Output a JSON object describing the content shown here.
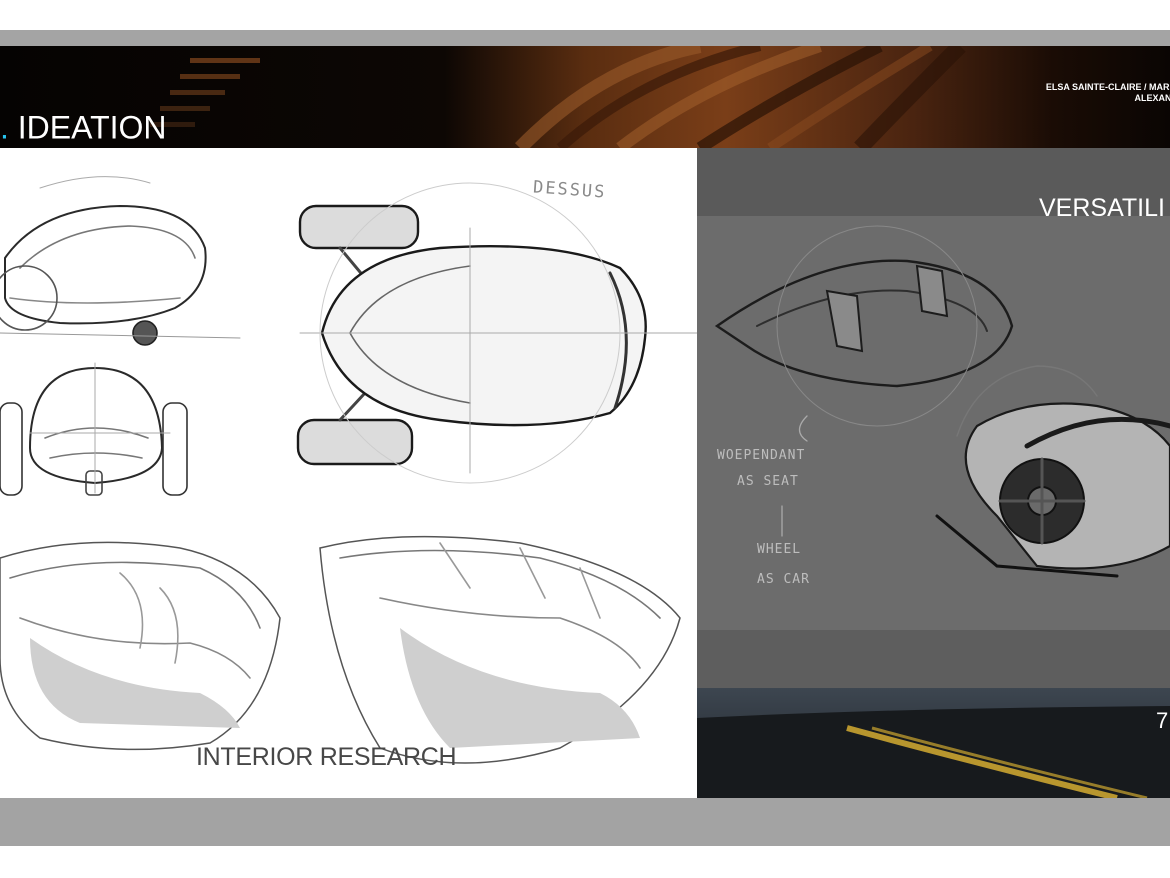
{
  "header": {
    "title_accent": ".",
    "title": " IDEATION",
    "credits_line1": "ELSA SAINTE-CLAIRE / MARIE",
    "credits_line2": "ALEXAND"
  },
  "left_panel": {
    "top_view_label": "DESSUS",
    "caption": "INTERIOR RESEARCH"
  },
  "right_panel": {
    "title": "VERSATILI",
    "handwriting": [
      "WOEPENDANT",
      "AS SEAT",
      "WHEEL",
      "AS CAR"
    ],
    "page_number": "7"
  },
  "colors": {
    "accent": "#27c4f0",
    "header_bg": "#0a0604",
    "right_panel_bg": "#6b6b6b",
    "frame": "#a4a4a4"
  }
}
